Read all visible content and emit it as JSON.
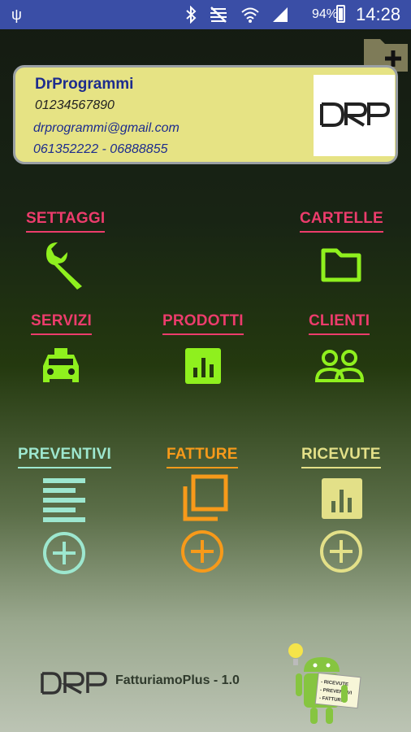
{
  "status_bar": {
    "battery": "94%",
    "time": "14:28"
  },
  "profile": {
    "name": "DrProgrammi",
    "phone": "01234567890",
    "email": "drprogrammi@gmail.com",
    "fax": "061352222 - 06888855"
  },
  "menu": {
    "settings": "SETTAGGI",
    "folders": "CARTELLE",
    "services": "SERVIZI",
    "products": "PRODOTTI",
    "clients": "CLIENTI",
    "quotes": "PREVENTIVI",
    "invoices": "FATTURE",
    "receipts": "RICEVUTE"
  },
  "footer": {
    "app_name": "FatturiamoPlus - 1.0"
  },
  "mascot_note": {
    "line1": "- RICEVUTE",
    "line2": "- PREVENTIVI",
    "line3": "- FATTURE"
  },
  "colors": {
    "settings_group": "#ec3c6c",
    "icon_green": "#8ff01e",
    "quotes": "#9de7cf",
    "invoices": "#f79a1a",
    "receipts": "#e3e088",
    "status_bar": "#3a4ea6"
  },
  "icons": [
    "usb-icon",
    "bluetooth-icon",
    "mute-icon",
    "wifi-icon",
    "signal-icon",
    "battery-icon",
    "folder-plus-icon",
    "wrench-icon",
    "folder-icon",
    "taxi-icon",
    "bar-chart-icon",
    "people-icon",
    "list-icon",
    "copy-icon",
    "add-circle-icon",
    "android-mascot-icon"
  ]
}
